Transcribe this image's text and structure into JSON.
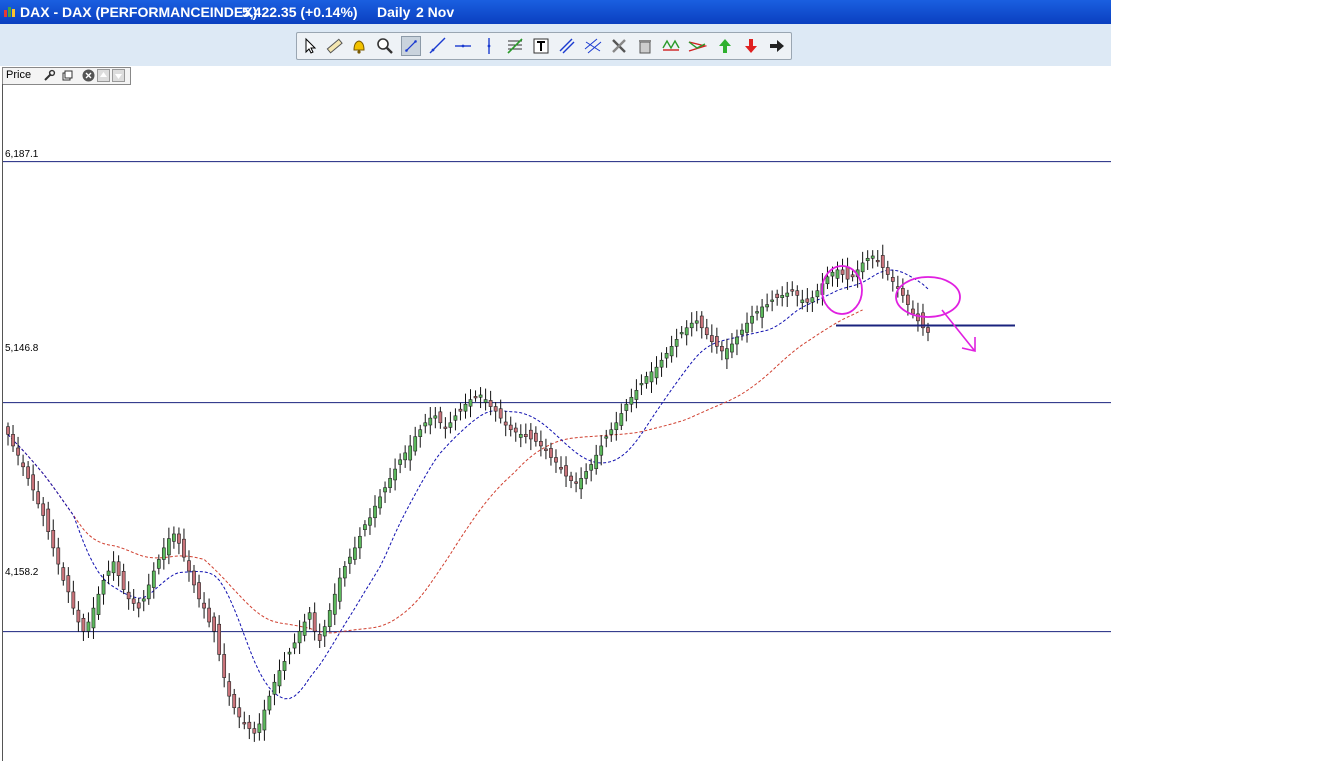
{
  "window": {
    "symbol": "DAX - DAX (PERFORMANCEINDEX)",
    "last": "5,422.35 (+0.14%)",
    "period": "Daily",
    "date": "2 Nov"
  },
  "pane": {
    "label": "Price"
  },
  "toolbar": {
    "buttons": [
      "select-arrow-icon",
      "ruler-icon",
      "alarm-bell-icon",
      "zoom-icon",
      "trendline-icon",
      "ray-icon",
      "horizontal-line-icon",
      "vertical-line-icon",
      "fibonacci-icon",
      "text-icon",
      "channel-icon",
      "parallel-lines-icon",
      "tools-icon",
      "trash-icon",
      "pattern-icon",
      "triangle-icon",
      "buy-arrow-icon",
      "sell-arrow-icon",
      "next-arrow-icon"
    ]
  },
  "colors": {
    "up": "#5cb85c",
    "down": "#c9737a",
    "ma_short": "#1010b0",
    "ma_long": "#d04030",
    "annotation": "#e020e0",
    "level_line": "#1a237e"
  },
  "chart_data": {
    "type": "candlestick",
    "title": "",
    "ylabel": "",
    "xlabel": "",
    "ylim": [
      3600,
      6600
    ],
    "grid": false,
    "horizontal_levels": [
      {
        "label": "6,187.1",
        "value": 6187.1
      },
      {
        "label": "5,146.8",
        "value": 5146.8
      },
      {
        "label": "4,158.2",
        "value": 4158.2
      }
    ],
    "support_level": 5480,
    "close_path": [
      5010,
      4960,
      4920,
      4870,
      4820,
      4770,
      4710,
      4660,
      4590,
      4520,
      4450,
      4380,
      4330,
      4260,
      4200,
      4160,
      4200,
      4260,
      4320,
      4380,
      4420,
      4460,
      4400,
      4340,
      4300,
      4280,
      4260,
      4300,
      4360,
      4420,
      4470,
      4520,
      4560,
      4580,
      4540,
      4480,
      4420,
      4360,
      4300,
      4260,
      4200,
      4160,
      4060,
      3960,
      3880,
      3830,
      3790,
      3760,
      3740,
      3720,
      3760,
      3820,
      3880,
      3940,
      3990,
      4030,
      4070,
      4110,
      4160,
      4200,
      4240,
      4160,
      4120,
      4180,
      4250,
      4320,
      4390,
      4440,
      4480,
      4520,
      4570,
      4620,
      4650,
      4700,
      4740,
      4780,
      4820,
      4860,
      4900,
      4930,
      4960,
      5000,
      5030,
      5060,
      5080,
      5090,
      5060,
      5040,
      5060,
      5090,
      5110,
      5140,
      5160,
      5170,
      5180,
      5160,
      5130,
      5110,
      5080,
      5050,
      5030,
      5020,
      5010,
      5000,
      4990,
      4980,
      4960,
      4940,
      4910,
      4890,
      4860,
      4830,
      4810,
      4800,
      4820,
      4850,
      4880,
      4920,
      4960,
      5000,
      5030,
      5060,
      5100,
      5140,
      5170,
      5200,
      5230,
      5260,
      5280,
      5300,
      5330,
      5360,
      5390,
      5420,
      5450,
      5470,
      5490,
      5500,
      5470,
      5440,
      5410,
      5390,
      5370,
      5380,
      5400,
      5430,
      5460,
      5490,
      5520,
      5540,
      5560,
      5570,
      5590,
      5600,
      5610,
      5620,
      5630,
      5610,
      5590,
      5580,
      5600,
      5630,
      5660,
      5690,
      5710,
      5720,
      5700,
      5680,
      5690,
      5720,
      5750,
      5770,
      5780,
      5760,
      5730,
      5700,
      5670,
      5640,
      5610,
      5570,
      5530,
      5500,
      5470,
      5450
    ],
    "series": [
      {
        "name": "",
        "type": "moving-average-short",
        "style": "dashed"
      },
      {
        "name": "",
        "type": "moving-average-long",
        "style": "dashed"
      }
    ],
    "annotations": [
      {
        "type": "ellipse"
      },
      {
        "type": "ellipse"
      },
      {
        "type": "arrow",
        "direction": "down-right"
      }
    ]
  }
}
